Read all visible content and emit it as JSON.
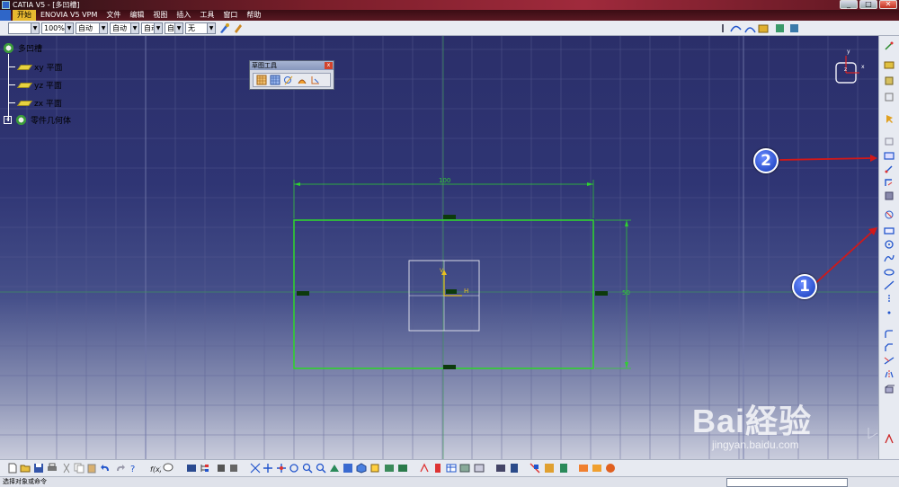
{
  "window": {
    "title": "CATIA V5 - [多凹槽]"
  },
  "menu": {
    "items": [
      "开始",
      "ENOVIA V5 VPM",
      "文件",
      "编辑",
      "视图",
      "插入",
      "工具",
      "窗口",
      "帮助"
    ]
  },
  "toolbar": {
    "zoom_value": "100%",
    "line_type": "自动",
    "line_weight": "自动",
    "layer": "自动",
    "layer2": "自动",
    "filter": "无"
  },
  "tree": {
    "root": "多凹槽",
    "items": [
      "xy 平面",
      "yz 平面",
      "zx 平面",
      "零件几何体"
    ]
  },
  "sketch_tools": {
    "title": "草图工具",
    "close": "x"
  },
  "sketch": {
    "width_dim": "100",
    "height_dim": "50",
    "axis_h": "H",
    "axis_v": "V"
  },
  "compass": {
    "z": "z",
    "x": "x",
    "y": "y"
  },
  "badges": {
    "one": "1",
    "two": "2"
  },
  "status": {
    "text": "选择对象或命令"
  },
  "watermark": {
    "brand": "Bai経验",
    "url": "jingyan.baidu.com"
  },
  "colors": {
    "sketch_green": "#2fd12f",
    "arrow_red": "#d21818",
    "grid": "#5a5f93"
  }
}
